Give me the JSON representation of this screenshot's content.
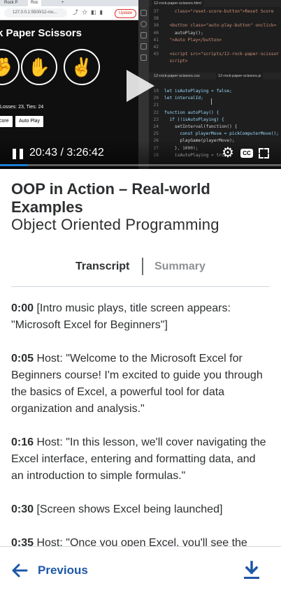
{
  "video": {
    "browser": {
      "tab_label": "Roc",
      "tab_label_prev": "Rock P",
      "new_tab": "+",
      "url": "127.0.0.1:5500/12-roc...",
      "update_label": "Update"
    },
    "game": {
      "title_visible": "k Paper Scissors",
      "buttons": [
        "✊",
        "✋",
        "✌"
      ],
      "score_text": "Losses: 23, Ties: 24",
      "reset_button": "core",
      "auto_play_button": "Auto Play"
    },
    "editor": {
      "tabs": [
        "12-rock-paper-scissors.html",
        "12-rock-paper-scissors.css",
        "12-rock-paper-scissors.js"
      ],
      "top_lines": [
        {
          "n": "37",
          "code": "    class=\"reset-score-button\">Reset Score"
        },
        {
          "n": "38",
          "code": ""
        },
        {
          "n": "39",
          "code": "  <button class=\"auto-play-button\" onclick="
        },
        {
          "n": "40",
          "code": "    autoPlay();"
        },
        {
          "n": "41",
          "code": "  \">Auto Play</button>"
        },
        {
          "n": "42",
          "code": ""
        },
        {
          "n": "43",
          "code": "  <script src=\"scripts/12-rock-paper-scissor"
        },
        {
          "n": "",
          "code": "  script>"
        }
      ],
      "bottom_lines": [
        {
          "n": "19",
          "code": "let isAutoPlaying = false;"
        },
        {
          "n": "20",
          "code": "let intervalId;"
        },
        {
          "n": "21",
          "code": ""
        },
        {
          "n": "22",
          "code": "function autoPlay() {"
        },
        {
          "n": "23",
          "code": "  if (!isAutoPlaying) {"
        },
        {
          "n": "24",
          "code": "    setInterval(function() {"
        },
        {
          "n": "25",
          "code": "      const playerMove = pickComputerMove();"
        },
        {
          "n": "26",
          "code": "      playGame(playerMove);"
        },
        {
          "n": "27",
          "code": "    }, 1000);"
        },
        {
          "n": "28",
          "code": "    isAutoPlaying = true;"
        }
      ]
    },
    "time_display": "20:43 / 3:26:42",
    "progress_fraction": 0.1,
    "cc_label": "CC",
    "accent_color": "#1c7ed6"
  },
  "lecture": {
    "title": "OOP in Action – Real-world Examples",
    "course": "Object Oriented Programming"
  },
  "tabs": {
    "transcript": "Transcript",
    "summary": "Summary",
    "active": "transcript"
  },
  "transcript": [
    {
      "time": "0:00",
      "text": " [Intro music plays, title screen appears: \"Microsoft Excel for Beginners\"]"
    },
    {
      "time": "0:05",
      "text": " Host: \"Welcome to the Microsoft Excel for Beginners course! I'm excited to guide you through the basics of Excel, a powerful tool for data organization and analysis.\""
    },
    {
      "time": "0:16",
      "text": " Host: \"In this lesson, we'll cover navigating the Excel interface, entering and formatting data, and an introduction to simple formulas.\""
    },
    {
      "time": "0:30",
      "text": " [Screen shows Excel being launched]"
    },
    {
      "time": "0:35",
      "text": " Host: \"Once you open Excel, you'll see the"
    }
  ],
  "footer": {
    "previous_label": "Previous",
    "link_color": "#1d57a8",
    "icons": [
      "arrow-left-icon",
      "download-icon"
    ]
  }
}
